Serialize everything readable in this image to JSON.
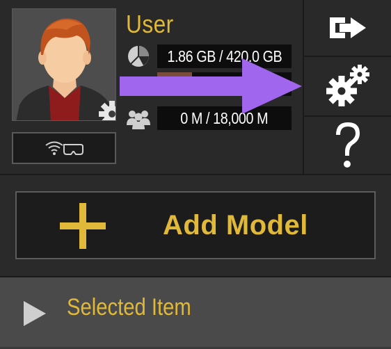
{
  "user": {
    "name": "User",
    "storage_label": "1.86 GB / 420.0 GB",
    "progress_fraction": 0.26,
    "members_label": "0 M / 18,000 M"
  },
  "add_model": {
    "label": "Add Model"
  },
  "selected": {
    "label": "Selected Item"
  },
  "icons": {
    "avatar_settings": "gear-icon",
    "wifi": "wifi-vr-headset-icon",
    "storage": "pie-chart-icon",
    "members": "users-icon",
    "logout": "logout-icon",
    "settings": "gears-icon",
    "help": "question-mark-icon",
    "add": "plus-icon",
    "expand": "play-triangle-icon"
  },
  "colors": {
    "accent": "#e0b93a",
    "panel": "#292929",
    "selected_bar": "#4a4a4a",
    "annotation_arrow": "#a066ee",
    "progress_fill": "#7a4e3a"
  }
}
